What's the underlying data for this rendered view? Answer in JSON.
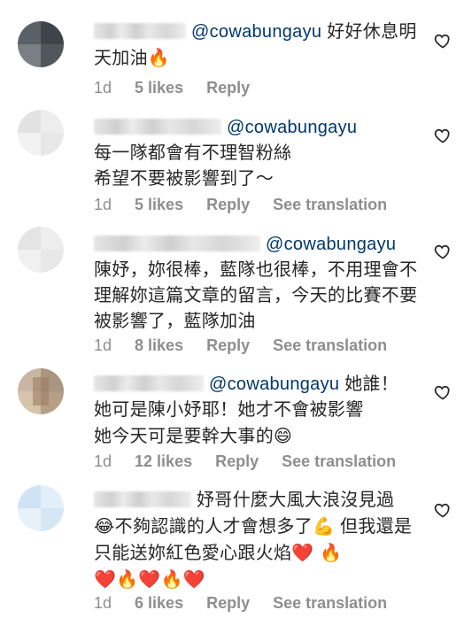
{
  "comments": [
    {
      "mention": "@cowabungayu",
      "text": "好好休息明天加油",
      "emoji": "🔥",
      "time": "1d",
      "likes": "5 likes",
      "reply": "Reply",
      "translate": ""
    },
    {
      "mention": "@cowabungayu",
      "text": "每一隊都會有不理智粉絲\n希望不要被影響到了～",
      "time": "1d",
      "likes": "5 likes",
      "reply": "Reply",
      "translate": "See translation"
    },
    {
      "mention": "@cowabungayu",
      "text": "陳妤，妳很棒，藍隊也很棒，不用理會不理解妳這篇文章的留言，今天的比賽不要被影響了，藍隊加油",
      "time": "1d",
      "likes": "8 likes",
      "reply": "Reply",
      "translate": "See translation"
    },
    {
      "mention": "@cowabungayu",
      "text_a": " 她誰！",
      "text_b": "她可是陳小妤耶！她才不會被影響",
      "text_c": "她今天可是要幹大事的",
      "emoji": "😄",
      "time": "1d",
      "likes": "12 likes",
      "reply": "Reply",
      "translate": "See translation"
    },
    {
      "text_a": "妤哥什麼大風大浪沒見過",
      "emoji_a": "😂",
      "text_b": "不夠認識的人才會想多了",
      "emoji_b": "💪",
      "text_c": " 但我還是只能送妳紅色愛心跟火焰",
      "emoji_c": "❤️ 🔥",
      "emoji_d": "❤️🔥❤️🔥❤️",
      "time": "1d",
      "likes": "6 likes",
      "reply": "Reply",
      "translate": "See translation"
    }
  ],
  "colors": {
    "text": "#262626",
    "meta": "#8e8e8e",
    "mention": "#00376b",
    "heart_stroke": "#262626"
  },
  "icons": {
    "like": "heart-outline-icon"
  }
}
